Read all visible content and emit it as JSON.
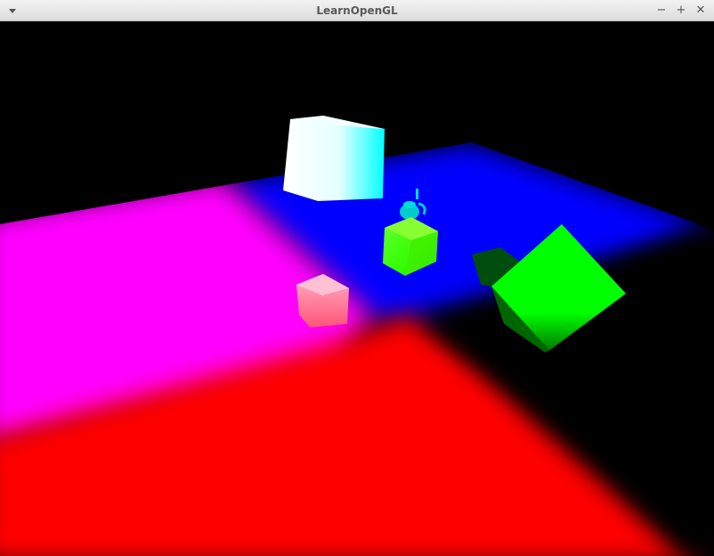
{
  "window": {
    "title": "LearnOpenGL",
    "menu_icon": "chevron-down-icon",
    "controls": {
      "minimize_glyph": "−",
      "maximize_glyph": "+",
      "close_glyph": "✕"
    }
  },
  "scene": {
    "background_color": "#000000",
    "floor_light_colors": [
      "#ff0000",
      "#ff00ff",
      "#0000ff",
      "#000000"
    ],
    "objects": [
      {
        "name": "floor-plane",
        "color": "#ff0000"
      },
      {
        "name": "white-cyan-cube",
        "color": "#00ffff"
      },
      {
        "name": "green-yellow-cube",
        "color": "#55ff00"
      },
      {
        "name": "teapot-figurine",
        "color": "#00d0d0"
      },
      {
        "name": "pink-cube",
        "color": "#ff8fb0"
      },
      {
        "name": "large-green-cube",
        "color": "#00ff00"
      }
    ]
  }
}
